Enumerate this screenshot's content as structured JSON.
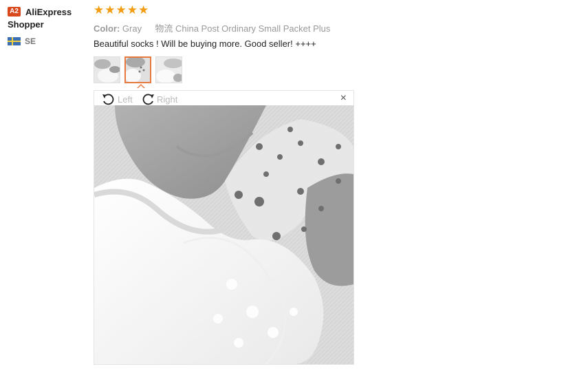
{
  "user": {
    "level_badge": "A2",
    "name_line1": "AliExpress",
    "name_line2": "Shopper",
    "country": "SE"
  },
  "feedback": {
    "star_count": 5,
    "color_label": "Color:",
    "color_value": "Gray",
    "logistics_label": "物流",
    "logistics_value": "China Post Ordinary Small Packet Plus",
    "text": "Beautiful socks ! Will be buying more. Good seller! ++++",
    "thumbnails": [
      "photo-1",
      "photo-2",
      "photo-3"
    ],
    "active_thumbnail": 2
  },
  "viewer": {
    "rotate_left": "Left",
    "rotate_right": "Right",
    "close": "×"
  },
  "colors": {
    "star": "#f39c12",
    "badge": "#d9481c",
    "active_border": "#e8793e"
  }
}
